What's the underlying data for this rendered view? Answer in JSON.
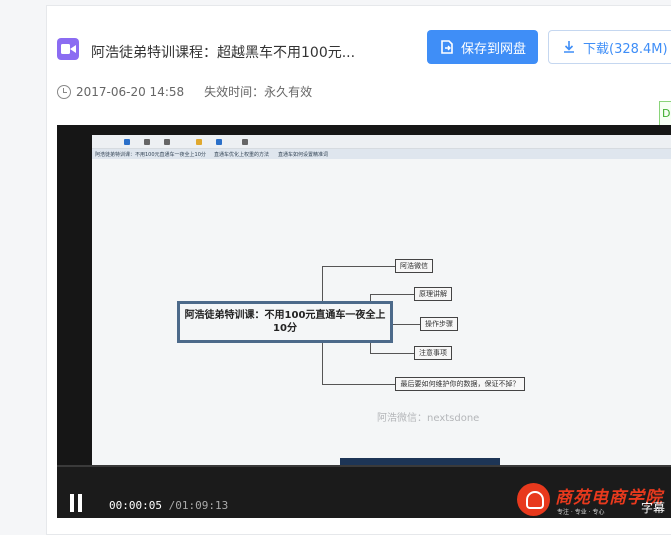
{
  "file": {
    "title": "阿浩徒弟特训课程：超越黑车不用100元...",
    "icon": "video-file-icon",
    "date": "2017-06-20 14:58",
    "expire": "失效时间：永久有效"
  },
  "actions": {
    "save_label": "保存到网盘",
    "download_label": "下载(328.4M)"
  },
  "side_tab": {
    "text": "D"
  },
  "video": {
    "tabs": [
      "阿浩徒弟特训课：不用100元直通车一夜全上10分",
      "直通车优化上权重的方法",
      "直通车如何设置精准词"
    ],
    "mindmap": {
      "root": "阿浩徒弟特训课：不用100元直通车一夜全上10分",
      "nodes": [
        "阿浩微信",
        "原理讲解",
        "操作步骤",
        "注意事项",
        "最后要如何维护你的数据，保证不掉？"
      ]
    },
    "watermark": "阿浩微信：nextsdone"
  },
  "player": {
    "current_time": "00:00:05",
    "total_time": "/01:09:13",
    "progress": 0.0012,
    "logo_text": "商苑电商学院",
    "logo_slogan": "专注 · 专业 · 专心",
    "subtitle_label": "字幕"
  },
  "colors": {
    "accent": "#3f8ef7",
    "file_icon": "#8b6cf2",
    "logo": "#e8391d"
  }
}
